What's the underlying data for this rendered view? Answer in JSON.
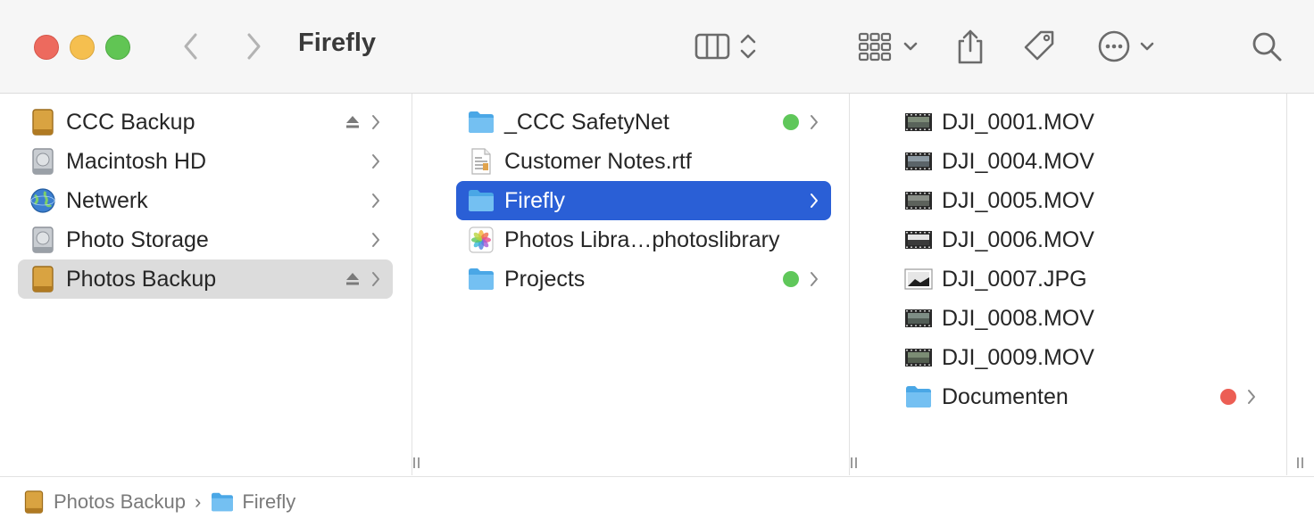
{
  "window": {
    "title": "Firefly"
  },
  "toolbar": {
    "icons": [
      "back-chevron-icon",
      "forward-chevron-icon",
      "columns-view-icon",
      "updown-chevron-icon",
      "grid-view-icon",
      "share-icon",
      "tag-icon",
      "more-icon",
      "search-icon"
    ]
  },
  "sidebar": {
    "items": [
      {
        "label": "CCC Backup",
        "icon": "external-drive-icon",
        "eject": true
      },
      {
        "label": "Macintosh HD",
        "icon": "internal-drive-icon",
        "eject": false
      },
      {
        "label": "Netwerk",
        "icon": "network-globe-icon",
        "eject": false
      },
      {
        "label": "Photo Storage",
        "icon": "internal-drive-icon",
        "eject": false
      },
      {
        "label": "Photos Backup",
        "icon": "external-drive-icon",
        "eject": true,
        "selected": true
      }
    ]
  },
  "column2": {
    "items": [
      {
        "label": "_CCC SafetyNet",
        "icon": "folder-icon",
        "tag_color": "#5fc75a",
        "folder": true
      },
      {
        "label": "Customer Notes.rtf",
        "icon": "rtf-document-icon"
      },
      {
        "label": "Firefly",
        "icon": "folder-icon",
        "folder": true,
        "selected": true
      },
      {
        "label": "Photos Libra…photoslibrary",
        "icon": "photos-library-icon"
      },
      {
        "label": "Projects",
        "icon": "folder-icon",
        "tag_color": "#5fc75a",
        "folder": true
      }
    ]
  },
  "column3": {
    "items": [
      {
        "label": "DJI_0001.MOV",
        "icon": "video-thumbnail-icon"
      },
      {
        "label": "DJI_0004.MOV",
        "icon": "video-thumbnail-icon"
      },
      {
        "label": "DJI_0005.MOV",
        "icon": "video-thumbnail-icon"
      },
      {
        "label": "DJI_0006.MOV",
        "icon": "video-thumbnail-icon"
      },
      {
        "label": "DJI_0007.JPG",
        "icon": "image-thumbnail-icon"
      },
      {
        "label": "DJI_0008.MOV",
        "icon": "video-thumbnail-icon"
      },
      {
        "label": "DJI_0009.MOV",
        "icon": "video-thumbnail-icon"
      },
      {
        "label": "Documenten",
        "icon": "folder-icon",
        "tag_color": "#ec5e54",
        "folder": true
      }
    ]
  },
  "pathbar": {
    "crumbs": [
      {
        "label": "Photos Backup",
        "icon": "external-drive-icon"
      },
      {
        "label": "Firefly",
        "icon": "folder-icon"
      }
    ],
    "separator": "›"
  },
  "colors": {
    "selection": "#2a5fd6",
    "sidebar_selection": "#dcdcdc"
  }
}
